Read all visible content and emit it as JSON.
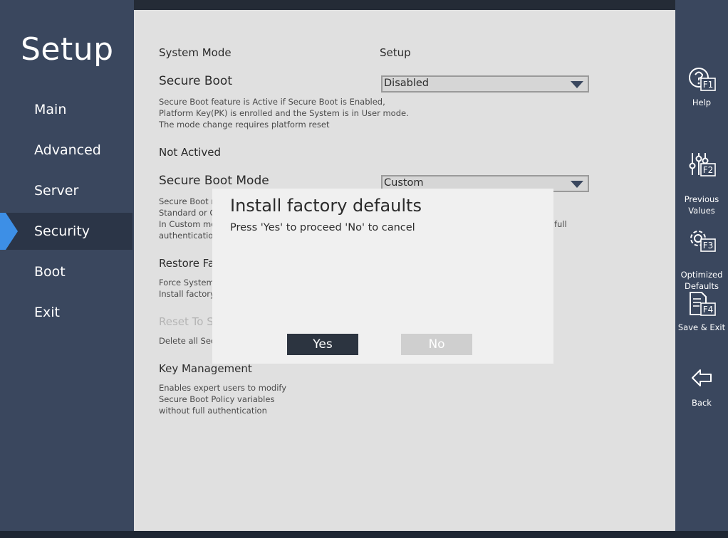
{
  "app": {
    "title": "Setup"
  },
  "nav": {
    "items": [
      {
        "label": "Main",
        "active": false
      },
      {
        "label": "Advanced",
        "active": false
      },
      {
        "label": "Server",
        "active": false
      },
      {
        "label": "Security",
        "active": true
      },
      {
        "label": "Boot",
        "active": false
      },
      {
        "label": "Exit",
        "active": false
      }
    ]
  },
  "content": {
    "system_mode": {
      "label": "System Mode",
      "value": "Setup"
    },
    "secure_boot": {
      "label": "Secure Boot",
      "value": "Disabled",
      "description": "Secure Boot feature is Active if Secure Boot is Enabled,\nPlatform Key(PK) is enrolled and the System is in User mode.\nThe mode change requires platform reset"
    },
    "status": "Not Actived",
    "secure_boot_mode": {
      "label": "Secure Boot Mode",
      "value": "Custom",
      "description_left": "Secure Boot m\nStandard or Cu\nIn Custom mo\nauthenticatio",
      "description_right": "full"
    },
    "restore": {
      "label": "Restore Fa",
      "description": "Force System\nInstall factory"
    },
    "reset": {
      "label": "Reset To S",
      "description": "Delete all Sec"
    },
    "key_management": {
      "label": "Key Management",
      "description": "Enables expert users to modify\nSecure Boot Policy variables\nwithout full authentication"
    }
  },
  "functions": [
    {
      "key": "F1",
      "label": "Help",
      "icon": "help-icon"
    },
    {
      "key": "F2",
      "label": "Previous\nValues",
      "icon": "sliders-icon"
    },
    {
      "key": "F3",
      "label": "Optimized\nDefaults",
      "icon": "gear-icon"
    },
    {
      "key": "F4",
      "label": "Save & Exit",
      "icon": "save-doc-icon"
    },
    {
      "key": "",
      "label": "Back",
      "icon": "back-arrow-icon"
    }
  ],
  "dialog": {
    "title": "Install factory defaults",
    "message": "Press 'Yes' to proceed 'No' to cancel",
    "yes_label": "Yes",
    "no_label": "No"
  },
  "colors": {
    "nav_bg": "#3a475e",
    "active_marker": "#3d8fe6",
    "content_bg": "#e0e0e0",
    "dialog_bg": "#f0f0f0",
    "yes_button": "#2c3440",
    "no_button": "#cfcfcf"
  }
}
